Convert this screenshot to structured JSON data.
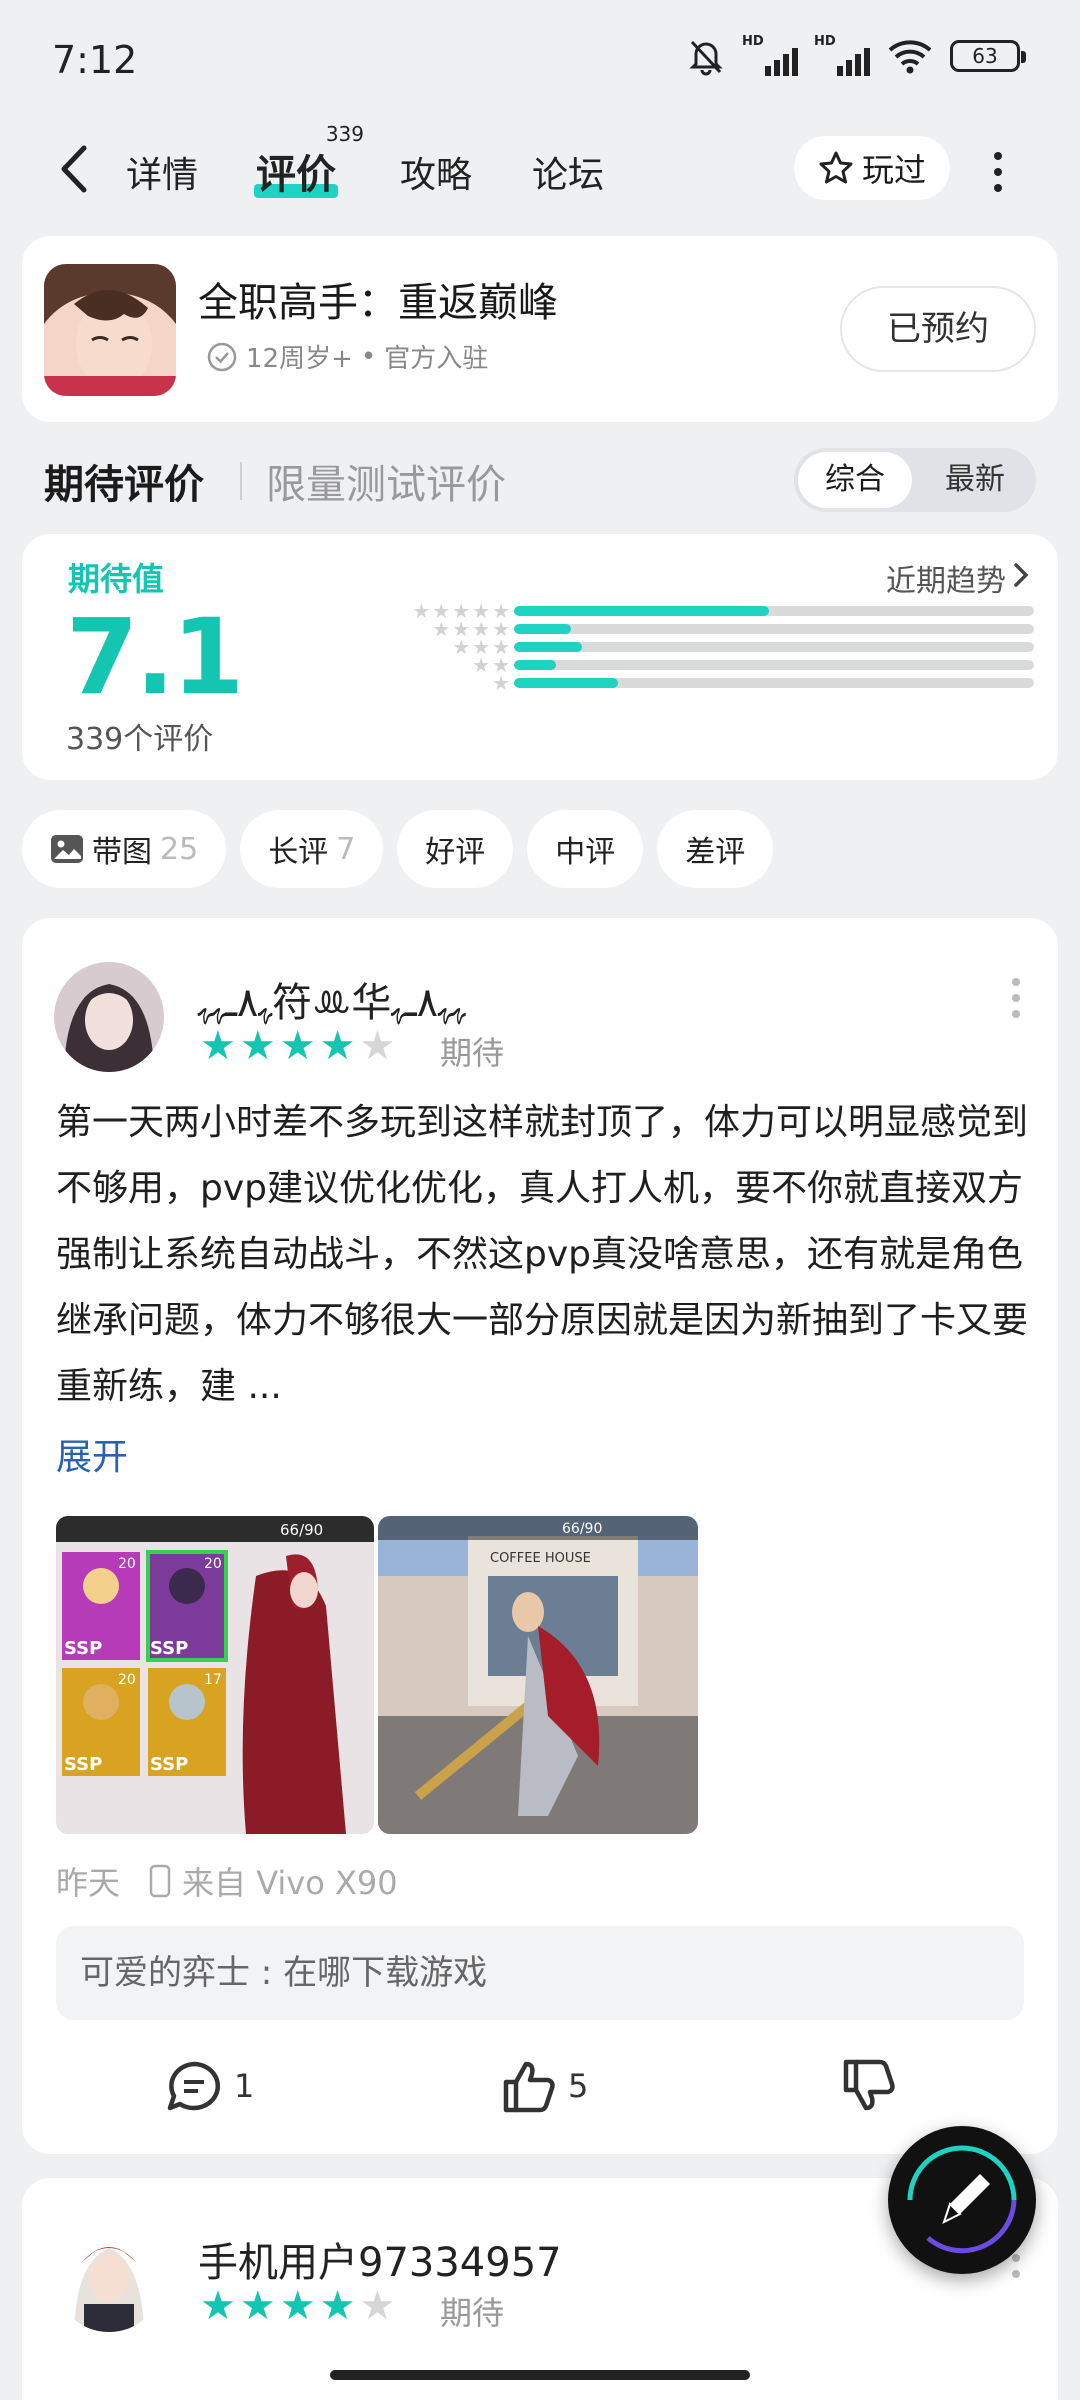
{
  "status": {
    "time": "7:12",
    "battery": "63",
    "signal_label": "HD"
  },
  "nav": {
    "tabs": [
      {
        "label": "详情"
      },
      {
        "label": "评价",
        "count": "339"
      },
      {
        "label": "攻略"
      },
      {
        "label": "论坛"
      }
    ],
    "played_label": "玩过"
  },
  "game": {
    "title": "全职高手：重返巅峰",
    "age": "12周岁+",
    "sep": "•",
    "official": "官方入驻",
    "reserved_label": "已预约"
  },
  "ratings": {
    "heading": "期待评价",
    "sub_heading": "限量测试评价",
    "sort_options": [
      "综合",
      "最新"
    ],
    "label": "期待值",
    "score": "7.1",
    "count_text": "339个评价",
    "trend_label": "近期趋势",
    "distribution": [
      {
        "stars": 5,
        "fraction": 0.49
      },
      {
        "stars": 4,
        "fraction": 0.11
      },
      {
        "stars": 3,
        "fraction": 0.13
      },
      {
        "stars": 2,
        "fraction": 0.08
      },
      {
        "stars": 1,
        "fraction": 0.2
      }
    ],
    "accent": "#14c6b2"
  },
  "filters": [
    {
      "label": "带图",
      "count": "25",
      "icon": "image-icon"
    },
    {
      "label": "长评",
      "count": "7"
    },
    {
      "label": "好评"
    },
    {
      "label": "中评"
    },
    {
      "label": "差评"
    }
  ],
  "review": {
    "user": "ﮩ٨ـﮩﮩ符ꔛ华ﮩﮩ٨ـﮩ",
    "stars": 4,
    "rating_label": "期待",
    "text": "第一天两小时差不多玩到这样就封顶了，体力可以明显感觉到不够用，pvp建议优化优化，真人打人机，要不你就直接双方强制让系统自动战斗，不然这pvp真没啥意思，还有就是角色继承问题，体力不够很大一部分原因就是因为新抽到了卡又要重新练，建 ...",
    "expand_label": "展开",
    "date": "昨天",
    "device": "来自 Vivo X90",
    "reply_preview": "可爱的弈士 : 在哪下载游戏",
    "comments": "1",
    "likes": "5",
    "screenshot1": {
      "energy": "66/90",
      "ranks": [
        "SSP",
        "SSP",
        "SSP",
        "SSP"
      ],
      "levels": [
        "20",
        "20",
        "20",
        "17"
      ]
    },
    "screenshot2": {
      "energy": "66/90",
      "shop_sign": "COFFEE HOUSE"
    }
  },
  "review2": {
    "user": "手机用户97334957",
    "stars": 4,
    "rating_label": "期待"
  }
}
